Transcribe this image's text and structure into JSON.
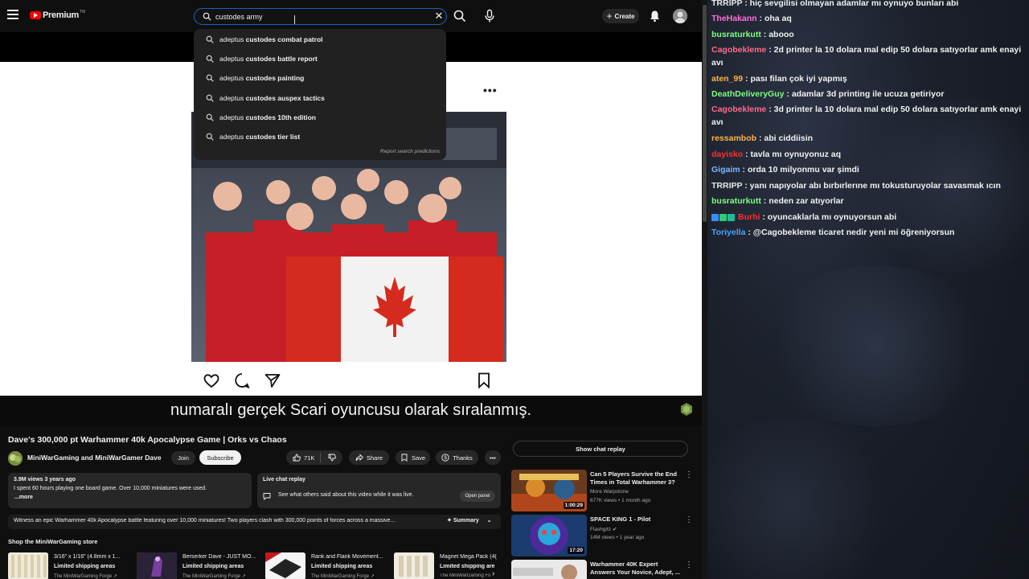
{
  "app": {
    "logo_text": "Premium",
    "logo_tm": "TM"
  },
  "search": {
    "value": "custodes army",
    "suggestions": [
      {
        "prefix": "adeptus ",
        "bold": "custodes combat patrol"
      },
      {
        "prefix": "adeptus ",
        "bold": "custodes battle report"
      },
      {
        "prefix": "adeptus ",
        "bold": "custodes painting"
      },
      {
        "prefix": "adeptus ",
        "bold": "custodes auspex tactics"
      },
      {
        "prefix": "adeptus ",
        "bold": "custodes 10th edition"
      },
      {
        "prefix": "adeptus ",
        "bold": "custodes tier list"
      }
    ],
    "report_label": "Report search predictions"
  },
  "header": {
    "create_label": "Create"
  },
  "player": {
    "subtitle": "numaralı gerçek Scari oyuncusu olarak sıralanmış.",
    "more_icon": "more-dots-icon"
  },
  "video": {
    "title": "Dave's 300,000 pt Warhammer 40k Apocalypse Game | Orks vs Chaos",
    "channel": "MiniWarGaming and MiniWarGamer Dave",
    "join_label": "Join",
    "subscribe_label": "Subscribe",
    "likes": "71K",
    "share_label": "Share",
    "save_label": "Save",
    "thanks_label": "Thanks",
    "views_meta": "3.9M views  3 years ago",
    "desc_line": "I spent 60 hours playing one board game. Over 10,000 miniatures were used.",
    "more_label": "...more",
    "live_title": "Live chat replay",
    "live_text": "See what others said about this video while it was live.",
    "open_panel_label": "Open panel",
    "summary_text": "Witness an epic Warhammer 40k Apocalypse battle featuring over 10,000 miniatures! Two players clash with 300,000 points of forces across a massive...",
    "summary_label": "Summary",
    "shop_title": "Shop the MiniWarGaming store",
    "shop_items": [
      {
        "name": "3/16\" x 1/16\" (4.8mm x 1...",
        "shipping": "Limited shipping areas",
        "seller": "The MiniWarGaming Forge ↗"
      },
      {
        "name": "Berserker Dave - JUST MO...",
        "shipping": "Limited shipping areas",
        "seller": "The MiniWarGaming Forge ↗"
      },
      {
        "name": "Rank and Flank Movement...",
        "shipping": "Limited shipping areas",
        "seller": "The MiniWarGaming Forge ↗"
      },
      {
        "name": "Magnet Mega Pack (4(",
        "shipping": "Limited shipping are",
        "seller": "The MiniWarGaming Fo"
      }
    ]
  },
  "sidebar": {
    "show_chat_label": "Show chat replay",
    "recommendations": [
      {
        "title": "Can 5 Players Survive the End Times in Total Warhammer 3?",
        "channel": "More Warpstone",
        "meta": "677K views • 1 month ago",
        "duration": "1:00:29"
      },
      {
        "title": "SPACE KING 1 - Pilot",
        "channel": "Flashgitz",
        "meta": "14M views • 1 year ago",
        "duration": "17:20"
      },
      {
        "title": "Warhammer 40K Expert Answers Your Novice, Adept, ...",
        "channel": "",
        "meta": "",
        "duration": ""
      }
    ]
  },
  "chat": {
    "messages": [
      {
        "user": "TRRIPP",
        "color": "#e6e6e6",
        "text": "hiç sevgilisi olmayan adamlar mı oynuyo bunları abi"
      },
      {
        "user": "TheHakann",
        "color": "#ff6fd8",
        "text": "oha aq"
      },
      {
        "user": "busraturkutt",
        "color": "#7dff7d",
        "text": "abooo"
      },
      {
        "user": "Cagobekleme",
        "color": "#ff6a8a",
        "text": "2d printer la 10 dolara mal edip 50 dolara satıyorlar amk enayi avı"
      },
      {
        "user": "aten_99",
        "color": "#ffb347",
        "text": "pası filan çok iyi yapmış"
      },
      {
        "user": "DeathDeliveryGuy",
        "color": "#7dff7d",
        "text": "adamlar 3d printing ile ucuza getiriyor"
      },
      {
        "user": "Cagobekleme",
        "color": "#ff6a8a",
        "text": "3d printer la 10 dolara mal edip 50 dolara satıyorlar amk enayi avı"
      },
      {
        "user": "ressambob",
        "color": "#ffb347",
        "text": "abi ciddiisin"
      },
      {
        "user": "dayisko",
        "color": "#ff3030",
        "text": "tavla mı oynuyonuz aq"
      },
      {
        "user": "Gigaim",
        "color": "#7ab8ff",
        "text": "orda 10 milyonmu var şimdi"
      },
      {
        "user": "TRRIPP",
        "color": "#e6e6e6",
        "text": "yanı napıyolar abı bırbırlerıne mı tokusturuyolar savasmak ıcın"
      },
      {
        "user": "busraturkutt",
        "color": "#7dff7d",
        "text": "neden zar atıyorlar"
      },
      {
        "user": "Burhi",
        "color": "#ff3030",
        "text": "oyuncaklarla mı oynuyorsun abi"
      },
      {
        "user": "Toriyella",
        "color": "#4aa3ff",
        "text": "@Cagobekleme ticaret nedir yeni mi öğreniyorsun"
      }
    ]
  }
}
